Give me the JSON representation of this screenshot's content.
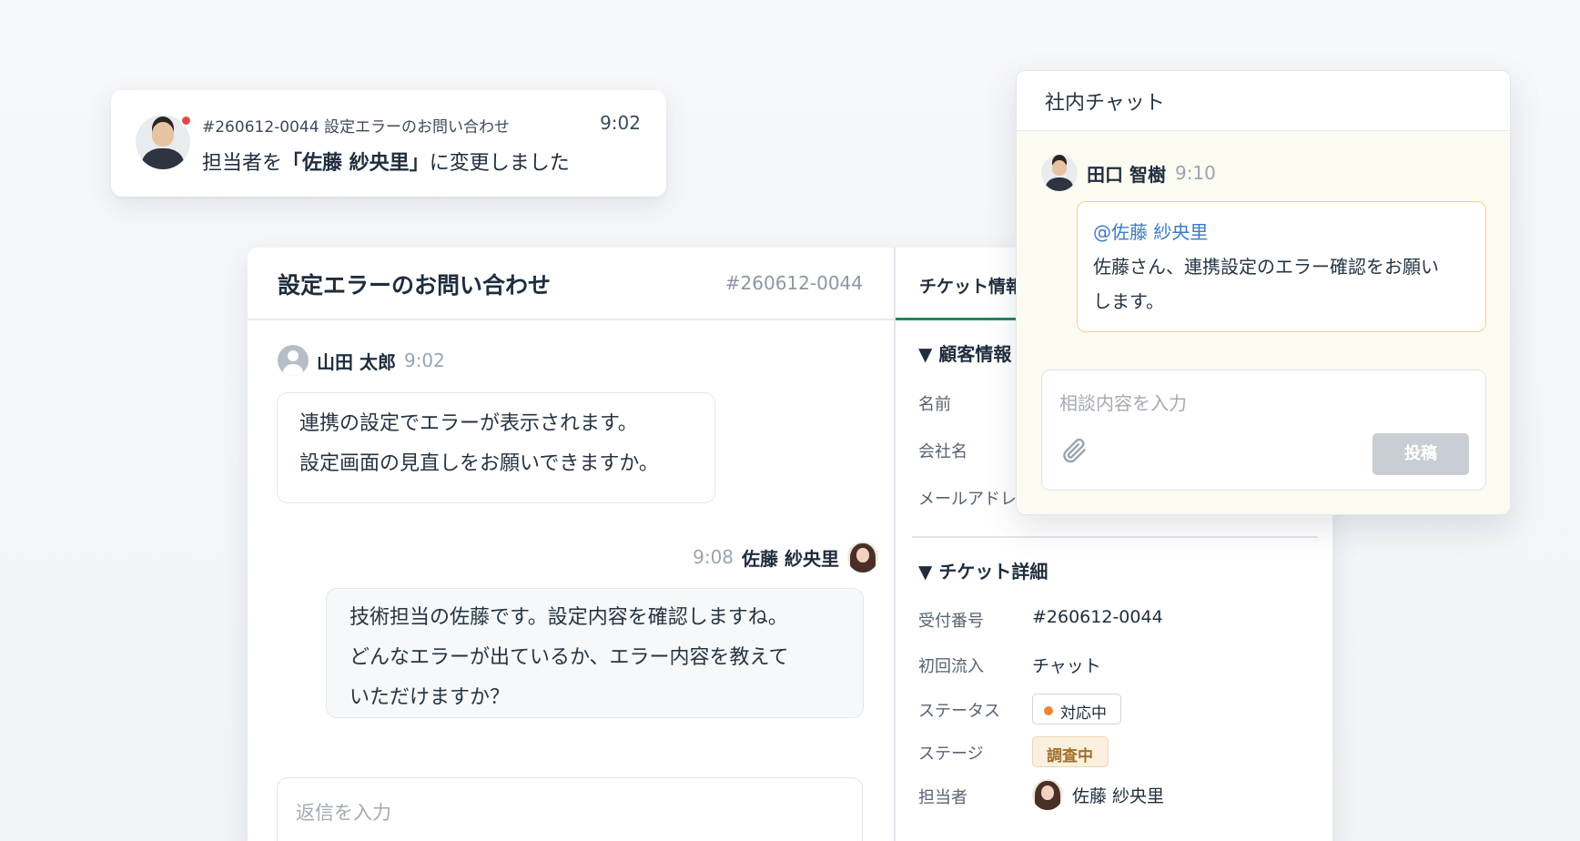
{
  "notification": {
    "ticket_ref": "#260612-0044 設定エラーのお問い合わせ",
    "time": "9:02",
    "message_prefix": "担当者を",
    "message_highlight": "「佐藤 紗央里」",
    "message_suffix": "に変更しました"
  },
  "ticket": {
    "title": "設定エラーのお問い合わせ",
    "number": "#260612-0044",
    "messages": [
      {
        "name": "山田 太郎",
        "time": "9:02",
        "lines": [
          "連携の設定でエラーが表示されます。",
          "設定画面の見直しをお願いできますか。"
        ]
      },
      {
        "name": "佐藤 紗央里",
        "time": "9:08",
        "lines": [
          "技術担当の佐藤です。設定内容を確認しますね。",
          "どんなエラーが出ているか、エラー内容を教えて",
          "いただけますか？"
        ]
      }
    ],
    "reply_placeholder": "返信を入力"
  },
  "sidebar": {
    "tab_label": "チケット情報",
    "customer_section": "▼ 顧客情報",
    "customer_labels": [
      "名前",
      "会社名",
      "メールアドレ"
    ],
    "detail_section": "▼ チケット詳細",
    "details": [
      {
        "label": "受付番号",
        "value": "#260612-0044"
      },
      {
        "label": "初回流入",
        "value": "チャット"
      },
      {
        "label": "ステータス",
        "value": "対応中"
      },
      {
        "label": "ステージ",
        "value": "調査中"
      },
      {
        "label": "担当者",
        "value": "佐藤 紗央里"
      }
    ],
    "colors": {
      "status_dot": "#f0843a",
      "tab_underline": "#1f8a5b"
    }
  },
  "internal_chat": {
    "title": "社内チャット",
    "sender": "田口 智樹",
    "time": "9:10",
    "mention": "@佐藤 紗央里",
    "body_lines": [
      "佐藤さん、連携設定のエラー確認をお願い",
      "します。"
    ],
    "input_placeholder": "相談内容を入力",
    "post_label": "投稿",
    "attach_icon": "paperclip-icon"
  }
}
